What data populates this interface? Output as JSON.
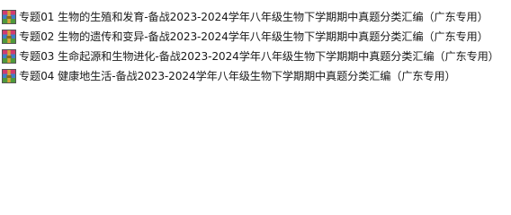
{
  "files": [
    {
      "name": "专题01 生物的生殖和发育-备战2023-2024学年八年级生物下学期期中真题分类汇编（广东专用）",
      "icon": "rar-archive-icon"
    },
    {
      "name": "专题02 生物的遗传和变异-备战2023-2024学年八年级生物下学期期中真题分类汇编（广东专用）",
      "icon": "rar-archive-icon"
    },
    {
      "name": "专题03 生命起源和生物进化-备战2023-2024学年八年级生物下学期期中真题分类汇编（广东专用）",
      "icon": "rar-archive-icon"
    },
    {
      "name": "专题04 健康地生活-备战2023-2024学年八年级生物下学期期中真题分类汇编（广东专用）",
      "icon": "rar-archive-icon"
    }
  ],
  "colors": {
    "icon_top": "#d23b6e",
    "icon_middle": "#3d7fc9",
    "icon_bottom": "#4f9a3c",
    "icon_band": "#d9a53b"
  }
}
